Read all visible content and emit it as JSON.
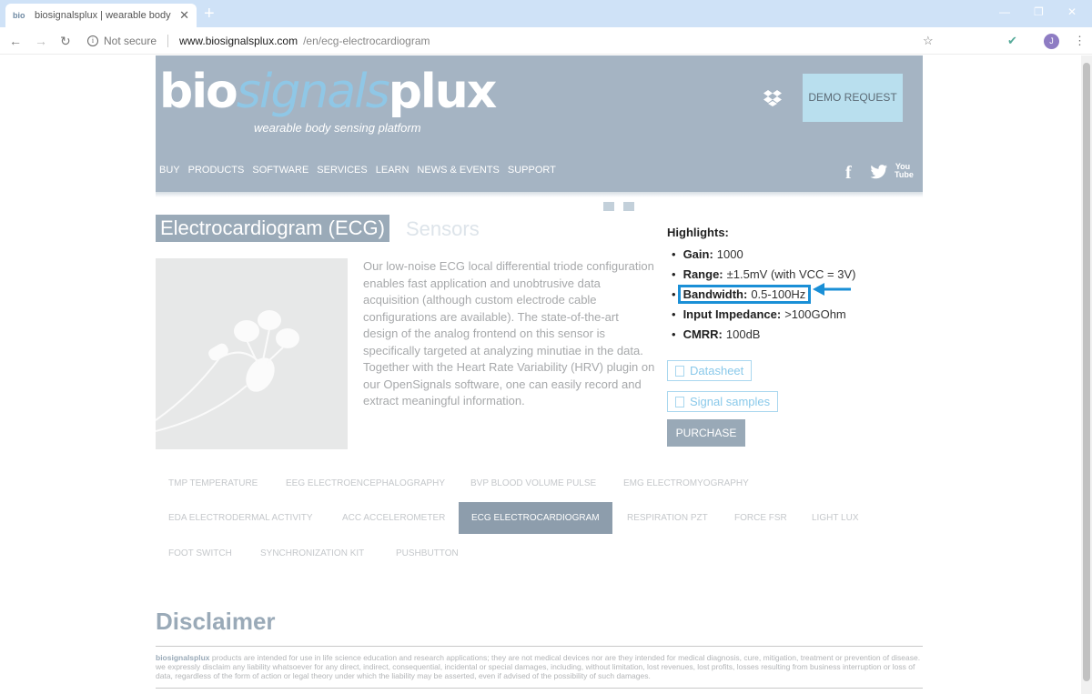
{
  "browser": {
    "tab_title": "biosignalsplux | wearable body s...",
    "tab_favicon": "bio",
    "newtab": "+",
    "security": "Not secure",
    "url_host": "www.biosignalsplux.com",
    "url_path": "/en/ecg-electrocardiogram",
    "avatar_initial": "J"
  },
  "header": {
    "logo_bio": "bio",
    "logo_signals": "signals",
    "logo_plux": "plux",
    "tagline": "wearable body sensing platform",
    "demo_request": "DEMO REQUEST",
    "nav": [
      "BUY",
      "PRODUCTS",
      "SOFTWARE",
      "SERVICES",
      "LEARN",
      "NEWS & EVENTS",
      "SUPPORT"
    ],
    "social": [
      "f",
      "twitter",
      "You Tube"
    ]
  },
  "product": {
    "title": "Electrocardiogram (ECG)",
    "subtitle": "Sensors",
    "description": "Our low-noise ECG local differential triode configuration enables fast application and unobtrusive data acquisition (although custom electrode cable configurations are available). The state-of-the-art design of the analog frontend on this sensor is specifically targeted at analyzing minutiae in the data. Together with the Heart Rate Variability (HRV) plugin on our OpenSignals software, one can easily record and extract meaningful information."
  },
  "highlights": {
    "title": "Highlights:",
    "items": [
      {
        "label": "Gain:",
        "value": "1000"
      },
      {
        "label": "Range:",
        "value": "±1.5mV (with VCC = 3V)"
      },
      {
        "label": "Bandwidth:",
        "value": "0.5-100Hz"
      },
      {
        "label": "Input Impedance:",
        "value": ">100GOhm"
      },
      {
        "label": "CMRR:",
        "value": "100dB"
      }
    ]
  },
  "buttons": {
    "datasheet": "Datasheet",
    "signal_samples": "Signal samples",
    "purchase": "PURCHASE"
  },
  "sensors": {
    "row1": [
      "TMP TEMPERATURE",
      "EEG ELECTROENCEPHALOGRAPHY",
      "BVP BLOOD VOLUME PULSE",
      "EMG ELECTROMYOGRAPHY"
    ],
    "row2": [
      "EDA ELECTRODERMAL ACTIVITY",
      "ACC ACCELEROMETER",
      "ECG ELECTROCARDIOGRAM",
      "RESPIRATION PZT",
      "FORCE FSR",
      "LIGHT LUX"
    ],
    "row3": [
      "FOOT SWITCH",
      "SYNCHRONIZATION KIT",
      "PUSHBUTTON"
    ]
  },
  "disclaimer": {
    "title": "Disclaimer",
    "brand": "biosignalsplux",
    "text": " products are intended for use in life science education and research applications; they are not medical devices nor are they intended for medical diagnosis, cure, mitigation, treatment or prevention of disease. we expressly disclaim any liability whatsoever for any direct, indirect, consequential, incidental or special damages, including, without limitation, lost revenues, lost profits, losses resulting from business interruption or loss of data, regardless of the form of action or legal theory under which the liability may be asserted, even if advised of the possibility of such damages."
  },
  "colors": {
    "header_bg": "#a5b4c3",
    "highlight_border": "#1a8fd6",
    "active_tab": "#8d9dac"
  }
}
